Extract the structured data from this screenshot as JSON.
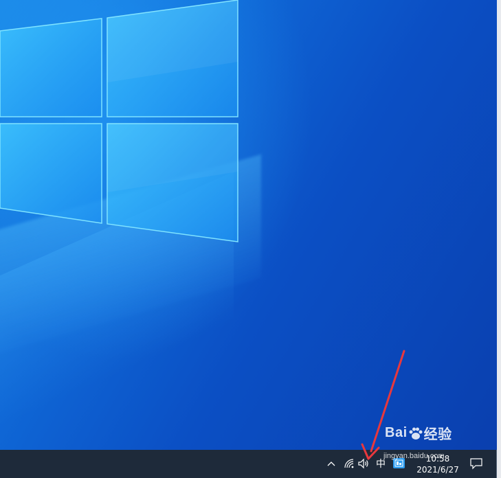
{
  "desktop": {
    "wallpaper": "windows-10-hero"
  },
  "taskbar": {
    "tray": {
      "show_hidden_icon": "chevron-up-icon",
      "network_icon": "wifi-icon",
      "volume_icon": "speaker-icon",
      "ime_label": "中",
      "app_icon": "app-tray-icon"
    },
    "clock": {
      "time": "10:58",
      "date": "2021/6/27"
    },
    "notification_icon": "action-center-icon"
  },
  "annotation": {
    "arrow_color": "#e8383d"
  },
  "watermark": {
    "logo_text_pre": "Bai",
    "logo_text_post": "经验",
    "url": "jingyan.baidu.com"
  }
}
